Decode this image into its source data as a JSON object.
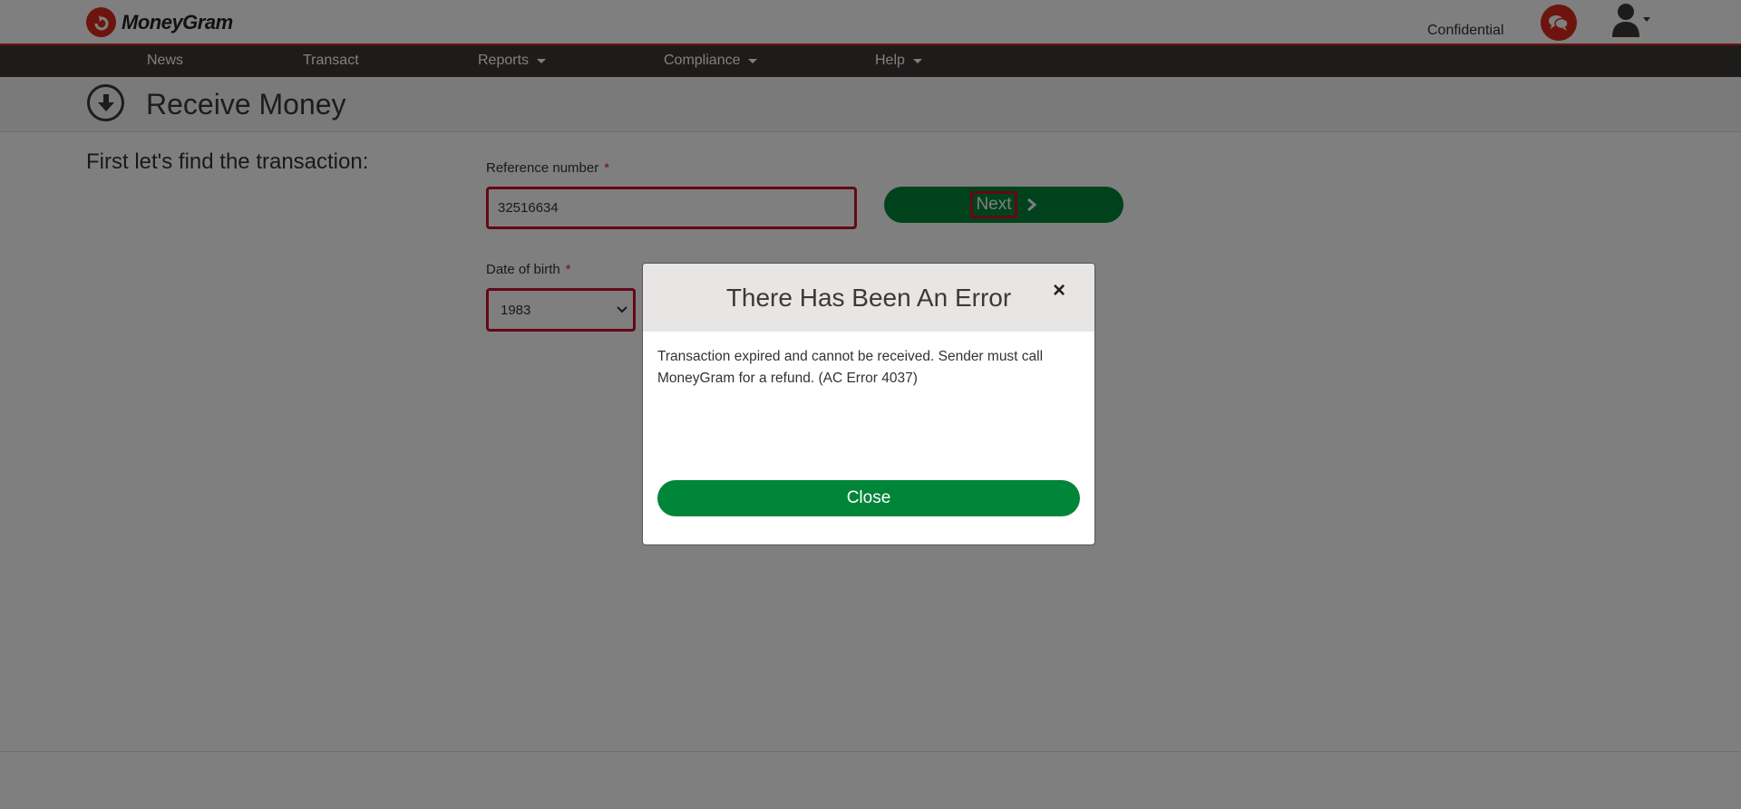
{
  "header": {
    "brand": "MoneyGram",
    "confidential": "Confidential"
  },
  "nav": {
    "items": [
      {
        "label": "News",
        "dropdown": false
      },
      {
        "label": "Transact",
        "dropdown": false
      },
      {
        "label": "Reports",
        "dropdown": true
      },
      {
        "label": "Compliance",
        "dropdown": true
      },
      {
        "label": "Help",
        "dropdown": true
      }
    ]
  },
  "page": {
    "title": "Receive Money",
    "subheading": "First let's find the transaction:"
  },
  "form": {
    "reference": {
      "label": "Reference number",
      "required_mark": "*",
      "value": "32516634"
    },
    "dob": {
      "label": "Date of birth",
      "required_mark": "*",
      "selected": "1983"
    },
    "next_label": "Next"
  },
  "modal": {
    "title": "There Has Been An Error",
    "close_icon": "×",
    "message": "Transaction expired and cannot be received. Sender must call MoneyGram for a refund. (AC Error 4037)",
    "close_label": "Close"
  },
  "colors": {
    "brand_red": "#da291c",
    "nav_bg": "#3d3935",
    "primary_green": "#008539"
  }
}
